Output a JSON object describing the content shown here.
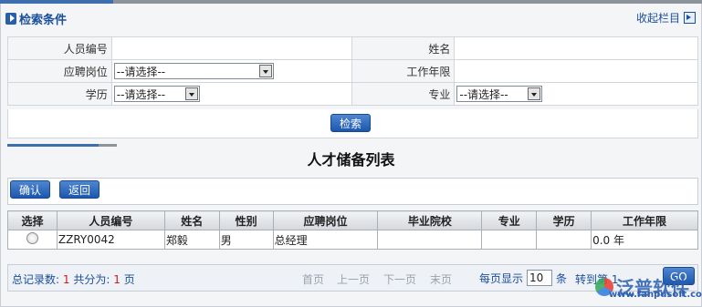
{
  "search_section": {
    "title": "检索条件",
    "collapse_label": "收起栏目",
    "fields": {
      "employee_no_label": "人员编号",
      "employee_no_value": "",
      "name_label": "姓名",
      "name_value": "",
      "position_label": "应聘岗位",
      "position_value": "--请选择--",
      "work_years_label": "工作年限",
      "work_years_value": "",
      "education_label": "学历",
      "education_value": "--请选择--",
      "major_label": "专业",
      "major_value": "--请选择--"
    },
    "search_button": "检索"
  },
  "list": {
    "title": "人才储备列表",
    "toolbar": {
      "confirm": "确认",
      "back": "返回"
    },
    "columns": [
      "选择",
      "人员编号",
      "姓名",
      "性别",
      "应聘岗位",
      "毕业院校",
      "专业",
      "学历",
      "工作年限"
    ],
    "rows": [
      {
        "id": "ZZRY0042",
        "name": "郑毅",
        "gender": "男",
        "position": "总经理",
        "school": "",
        "major": "",
        "education": "",
        "work_years": "0.0 年"
      }
    ]
  },
  "pagination": {
    "total_label": "总记录数:",
    "total_count": "1",
    "pages_label": "共分为:",
    "page_count": "1",
    "pages_unit": "页",
    "first": "首页",
    "prev": "上一页",
    "next": "下一页",
    "last": "末页",
    "page_size_label": "每页显示",
    "page_size": "10",
    "page_size_unit": "条",
    "goto_label": "转到第",
    "goto_page": "1",
    "go_button": "GO"
  },
  "watermark": {
    "brand": "泛普软件",
    "url": "www.fanpusoft.com"
  },
  "colors": {
    "accent": "#1a4f9c",
    "button": "#2a62b5",
    "count_red": "#d21a1a"
  }
}
